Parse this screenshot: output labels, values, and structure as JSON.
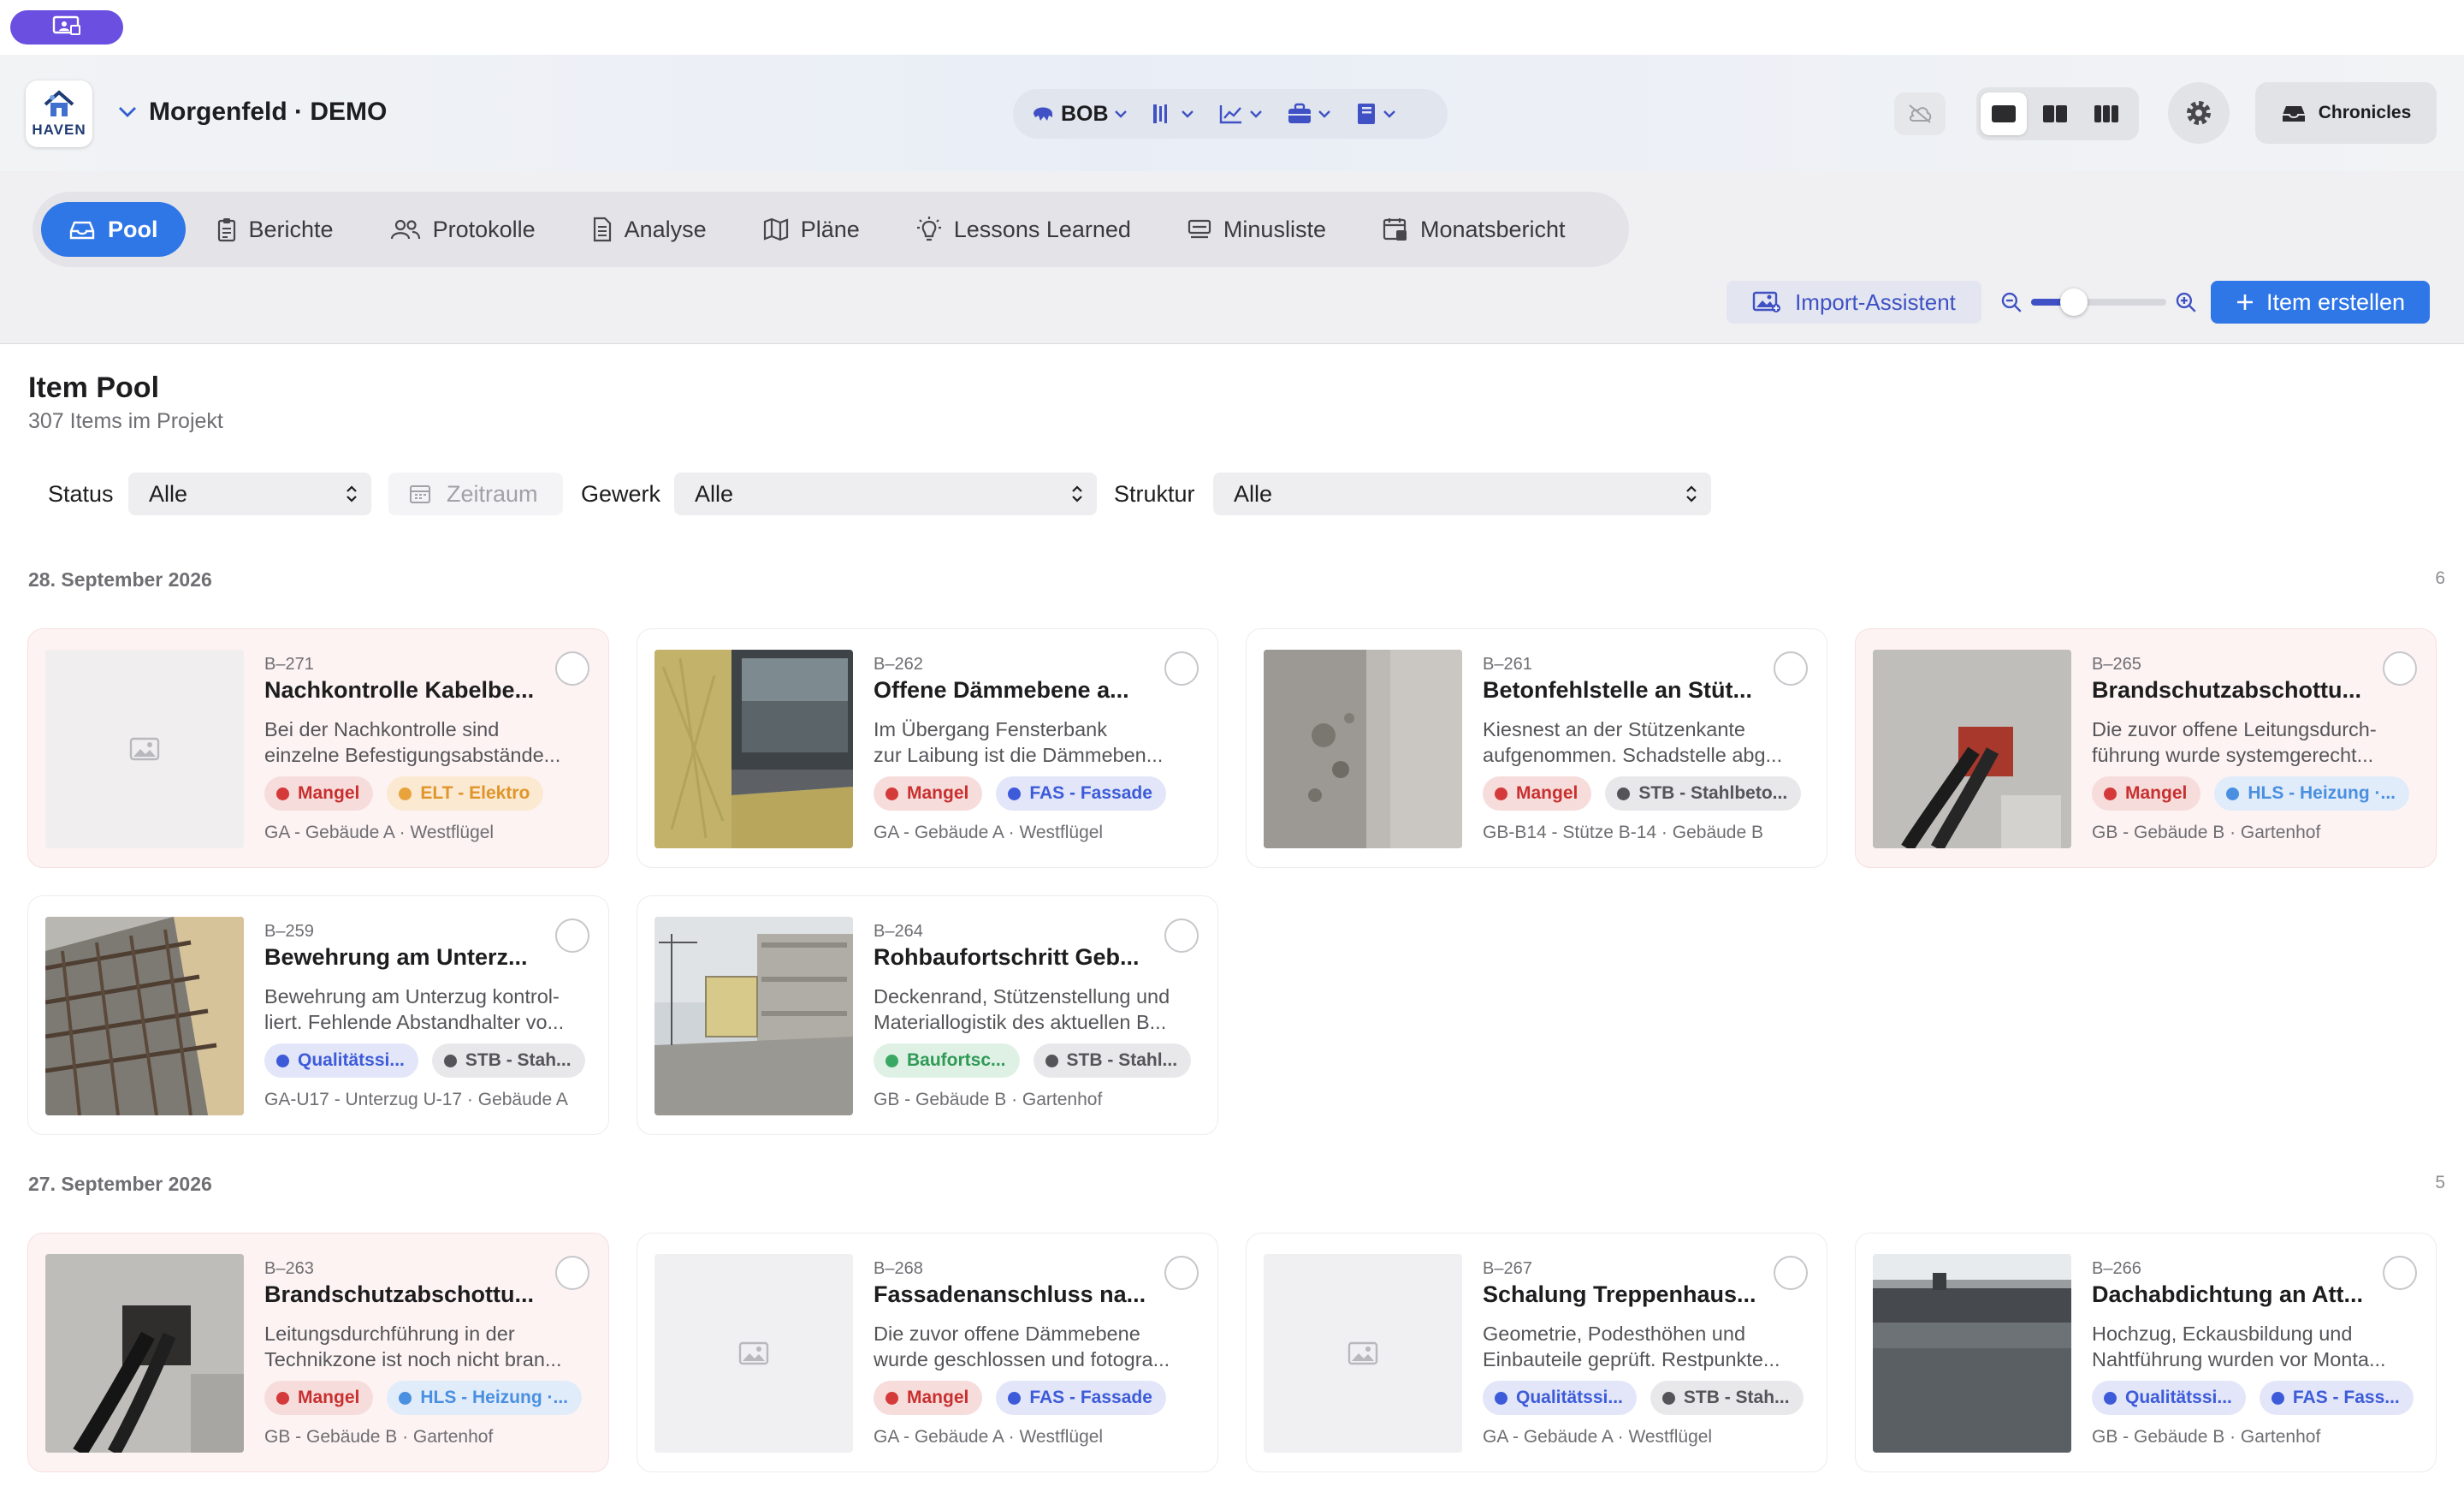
{
  "colors": {
    "accent": "#2f76e6",
    "indigo": "#3f51c4",
    "mangel": "#d43a3a",
    "elektro": "#e8a33b",
    "fassade": "#3d5bd9",
    "stahlbeton": "#555559",
    "heizung": "#4a8fe0",
    "qualitaet": "#3d5bd9",
    "baufortschritt": "#3aa865"
  },
  "topbar": {
    "screen_icon": "screen-share-icon"
  },
  "header": {
    "logo_text": "HAVEN",
    "project_name": "Morgenfeld · DEMO",
    "center_tools": {
      "assistant_label": "BOB"
    },
    "chronicles_label": "Chronicles"
  },
  "tabs": [
    {
      "label": "Pool",
      "icon": "pool-icon"
    },
    {
      "label": "Berichte",
      "icon": "clipboard-icon"
    },
    {
      "label": "Protokolle",
      "icon": "people-icon"
    },
    {
      "label": "Analyse",
      "icon": "document-icon"
    },
    {
      "label": "Pläne",
      "icon": "map-icon"
    },
    {
      "label": "Lessons Learned",
      "icon": "lightbulb-icon"
    },
    {
      "label": "Minusliste",
      "icon": "list-icon"
    },
    {
      "label": "Monatsbericht",
      "icon": "calendar-report-icon"
    }
  ],
  "actions": {
    "import_label": "Import-Assistent",
    "create_label": "Item erstellen",
    "zoom_level": 0.25
  },
  "page": {
    "title": "Item Pool",
    "subtitle": "307 Items im Projekt"
  },
  "filters": {
    "status_label": "Status",
    "status_value": "Alle",
    "date_placeholder": "Zeitraum",
    "gewerk_label": "Gewerk",
    "gewerk_value": "Alle",
    "struktur_label": "Struktur",
    "struktur_value": "Alle"
  },
  "sections": [
    {
      "date": "28. September 2026",
      "count": "6",
      "cards": [
        {
          "id": "B–271",
          "title": "Nachkontrolle Kabelbe...",
          "desc1": "Bei der Nachkontrolle sind",
          "desc2": "einzelne Befestigungsabstände...",
          "tags": [
            {
              "label": "Mangel",
              "kind": "mangel"
            },
            {
              "label": "ELT - Elektro",
              "kind": "elektro"
            }
          ],
          "location": "GA - Gebäude A · Westflügel",
          "image": "none"
        },
        {
          "id": "B–262",
          "title": "Offene Dämmebene a...",
          "desc1": "Im Übergang Fensterbank",
          "desc2": "zur Laibung ist die Dämmeben...",
          "tags": [
            {
              "label": "Mangel",
              "kind": "mangel"
            },
            {
              "label": "FAS - Fassade",
              "kind": "fassade"
            }
          ],
          "location": "GA - Gebäude A · Westflügel",
          "image": "insulation-window"
        },
        {
          "id": "B–261",
          "title": "Betonfehlstelle an Stüt...",
          "desc1": "Kiesnest an der Stützenkante",
          "desc2": "aufgenommen. Schadstelle abg...",
          "tags": [
            {
              "label": "Mangel",
              "kind": "mangel"
            },
            {
              "label": "STB - Stahlbeto...",
              "kind": "stahlbeton"
            }
          ],
          "location": "GB-B14 - Stütze B-14 · Gebäude B",
          "image": "concrete-column"
        },
        {
          "id": "B–265",
          "title": "Brandschutzabschottu...",
          "desc1": "Die zuvor offene Leitungsdurch-",
          "desc2": "führung wurde systemgerecht...",
          "tags": [
            {
              "label": "Mangel",
              "kind": "mangel"
            },
            {
              "label": "HLS - Heizung ·...",
              "kind": "heizung"
            }
          ],
          "location": "GB - Gebäude B · Gartenhof",
          "image": "fire-seal"
        },
        {
          "id": "B–259",
          "title": "Bewehrung am Unterz...",
          "desc1": "Bewehrung am Unterzug kontrol-",
          "desc2": "liert. Fehlende Abstandhalter vo...",
          "tags": [
            {
              "label": "Qualitätssi...",
              "kind": "qualitaet"
            },
            {
              "label": "STB - Stah...",
              "kind": "stahlbeton"
            }
          ],
          "location": "GA-U17 - Unterzug U-17 · Gebäude A",
          "image": "rebar"
        },
        {
          "id": "B–264",
          "title": "Rohbaufortschritt Geb...",
          "desc1": "Deckenrand, Stützenstellung und",
          "desc2": "Materiallogistik des aktuellen B...",
          "tags": [
            {
              "label": "Baufortsc...",
              "kind": "baufortschritt"
            },
            {
              "label": "STB - Stahl...",
              "kind": "stahlbeton"
            }
          ],
          "location": "GB - Gebäude B · Gartenhof",
          "image": "building-site"
        }
      ]
    },
    {
      "date": "27. September 2026",
      "count": "5",
      "cards": [
        {
          "id": "B–263",
          "title": "Brandschutzabschottu...",
          "desc1": "Leitungsdurchführung in der",
          "desc2": "Technikzone ist noch nicht bran...",
          "tags": [
            {
              "label": "Mangel",
              "kind": "mangel"
            },
            {
              "label": "HLS - Heizung ·...",
              "kind": "heizung"
            }
          ],
          "location": "GB - Gebäude B · Gartenhof",
          "image": "pipe-opening"
        },
        {
          "id": "B–268",
          "title": "Fassadenanschluss na...",
          "desc1": "Die zuvor offene Dämmebene",
          "desc2": "wurde geschlossen und fotogra...",
          "tags": [
            {
              "label": "Mangel",
              "kind": "mangel"
            },
            {
              "label": "FAS - Fassade",
              "kind": "fassade"
            }
          ],
          "location": "GA - Gebäude A · Westflügel",
          "image": "none"
        },
        {
          "id": "B–267",
          "title": "Schalung Treppenhaus...",
          "desc1": "Geometrie, Podesthöhen und",
          "desc2": "Einbauteile geprüft. Restpunkte...",
          "tags": [
            {
              "label": "Qualitätssi...",
              "kind": "qualitaet"
            },
            {
              "label": "STB - Stah...",
              "kind": "stahlbeton"
            }
          ],
          "location": "GA - Gebäude A · Westflügel",
          "image": "none"
        },
        {
          "id": "B–266",
          "title": "Dachabdichtung an Att...",
          "desc1": "Hochzug, Eckausbildung und",
          "desc2": "Nahtführung wurden vor Monta...",
          "tags": [
            {
              "label": "Qualitätssi...",
              "kind": "qualitaet"
            },
            {
              "label": "FAS - Fass...",
              "kind": "fassade"
            }
          ],
          "location": "GB - Gebäude B · Gartenhof",
          "image": "roof"
        }
      ]
    }
  ]
}
